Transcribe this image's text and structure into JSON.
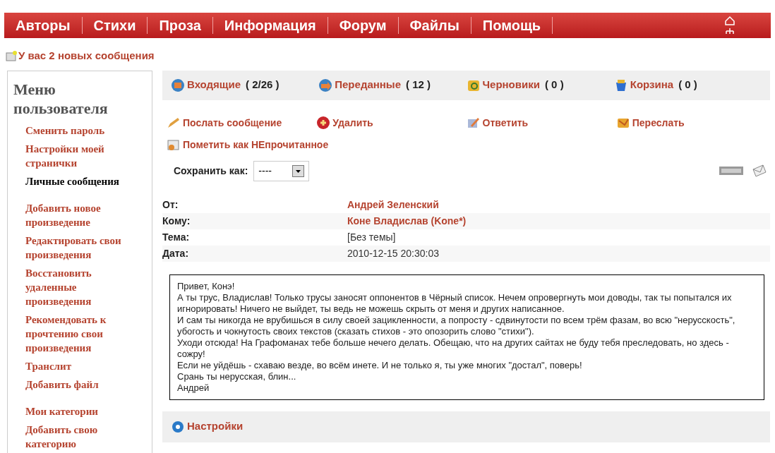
{
  "nav": {
    "items": [
      {
        "label": "Авторы"
      },
      {
        "label": "Стихи"
      },
      {
        "label": "Проза"
      },
      {
        "label": "Информация"
      },
      {
        "label": "Форум"
      },
      {
        "label": "Файлы"
      },
      {
        "label": "Помощь"
      }
    ]
  },
  "notice": "У вас 2 новых сообщения",
  "sidebar": {
    "title": "Меню пользователя",
    "groups": [
      [
        {
          "label": "Сменить пароль",
          "selected": false
        },
        {
          "label": "Настройки моей странички",
          "selected": false
        },
        {
          "label": "Личные сообщения",
          "selected": true
        }
      ],
      [
        {
          "label": "Добавить новое произведение",
          "selected": false
        },
        {
          "label": "Редактировать свои произведения",
          "selected": false
        },
        {
          "label": "Восстановить удаленные произведения",
          "selected": false
        },
        {
          "label": "Рекомендовать к прочтению свои произведения",
          "selected": false
        },
        {
          "label": "Транслит",
          "selected": false
        },
        {
          "label": "Добавить файл",
          "selected": false
        }
      ],
      [
        {
          "label": "Мои категории",
          "selected": false
        },
        {
          "label": "Добавить свою категорию",
          "selected": false
        }
      ]
    ]
  },
  "folders": [
    {
      "label": "Входящие",
      "count": "( 2/26 )",
      "kind": "inbox"
    },
    {
      "label": "Переданные",
      "count": "( 12 )",
      "kind": "sent"
    },
    {
      "label": "Черновики",
      "count": "( 0 )",
      "kind": "drafts"
    },
    {
      "label": "Корзина",
      "count": "( 0 )",
      "kind": "trash"
    }
  ],
  "actions": [
    {
      "label": "Послать сообщение",
      "kind": "send"
    },
    {
      "label": "Удалить",
      "kind": "delete"
    },
    {
      "label": "Ответить",
      "kind": "reply"
    },
    {
      "label": "Переслать",
      "kind": "forward"
    },
    {
      "label": "Пометить как НЕпрочитанное",
      "kind": "unread"
    }
  ],
  "save_as": {
    "label": "Сохранить как:",
    "value": "----"
  },
  "fields": [
    {
      "label": "От:",
      "value": "Андрей Зеленский",
      "kind": "link"
    },
    {
      "label": "Кому:",
      "value": "Коне Владислав (Kone*)",
      "kind": "link"
    },
    {
      "label": "Тема:",
      "value": "[Без темы]",
      "kind": "text"
    },
    {
      "label": "Дата:",
      "value": "2010-12-15 20:30:03",
      "kind": "text"
    }
  ],
  "message": [
    "Привет, Конэ!",
    "А ты трус, Владислав! Только трусы заносят оппонентов в Чёрный список. Нечем опровергнуть мои доводы, так ты попытался их игнорировать! Ничего не выйдет, ты ведь не можешь скрыть от меня и других написанное.",
    "И сам ты никогда не врубишься в силу своей зацикленности, а попросту - сдвинутости по всем трём фазам, во всю \"нерусскость\", убогость и чокнутость своих текстов (сказать стихов - это опозорить слово \"стихи\").",
    "Уходи отсюда! На Графоманах тебе больше нечего делать. Обещаю, что на других сайтах не буду тебя преследовать, но здесь - сожру!",
    "Если не уйдёшь - схаваю везде, во всём инете. И не только я, ты уже многих \"достал\", поверь!",
    "Срань ты нерусская, блин...",
    "Андрей"
  ],
  "settings": {
    "label": "Настройки"
  }
}
